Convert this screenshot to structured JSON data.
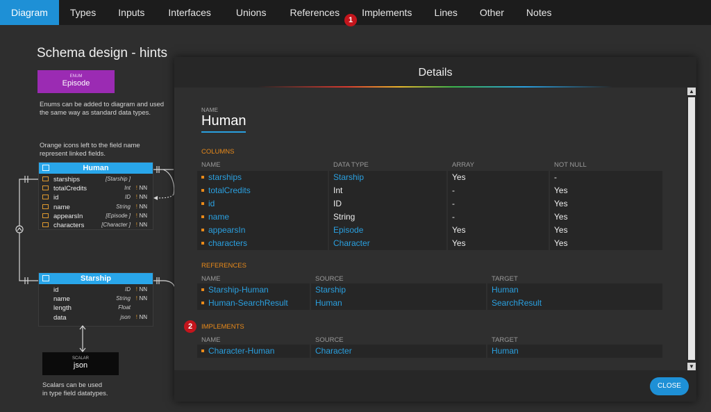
{
  "nav": {
    "tabs": [
      "Diagram",
      "Types",
      "Inputs",
      "Interfaces",
      "Unions",
      "References",
      "Implements",
      "Lines",
      "Other",
      "Notes"
    ],
    "active": "Diagram",
    "badge": "1"
  },
  "diagram": {
    "title": "Schema design - hints",
    "enum": {
      "kind": "ENUM",
      "name": "Episode"
    },
    "enum_hint": [
      "Enums can be added to diagram and used",
      "the same way as standard data types."
    ],
    "linked_hint": [
      "Orange icons left to the field name",
      "represent linked fields."
    ],
    "human": {
      "name": "Human",
      "fields": [
        {
          "name": "starships",
          "type": "[Starship ]",
          "bang": "",
          "nn": ""
        },
        {
          "name": "totalCredits",
          "type": "Int",
          "bang": "!",
          "nn": "NN"
        },
        {
          "name": "id",
          "type": "ID",
          "bang": "!",
          "nn": "NN"
        },
        {
          "name": "name",
          "type": "String",
          "bang": "!",
          "nn": "NN"
        },
        {
          "name": "appearsIn",
          "type": "[Episode ]",
          "bang": "!",
          "nn": "NN"
        },
        {
          "name": "characters",
          "type": "[Character ]",
          "bang": "!",
          "nn": "NN"
        }
      ]
    },
    "starship": {
      "name": "Starship",
      "fields": [
        {
          "name": "id",
          "type": "ID",
          "bang": "!",
          "nn": "NN"
        },
        {
          "name": "name",
          "type": "String",
          "bang": "!",
          "nn": "NN"
        },
        {
          "name": "length",
          "type": "Float",
          "bang": "",
          "nn": ""
        },
        {
          "name": "data",
          "type": "json",
          "bang": "!",
          "nn": "NN"
        }
      ]
    },
    "scalar": {
      "kind": "SCALAR",
      "name": "json"
    },
    "scalar_hint": [
      "Scalars can be used",
      "in type field datatypes."
    ]
  },
  "modal": {
    "title": "Details",
    "name_label": "NAME",
    "name": "Human",
    "columns": {
      "title": "COLUMNS",
      "headers": [
        "NAME",
        "DATA TYPE",
        "ARRAY",
        "NOT NULL"
      ],
      "rows": [
        [
          "starships",
          "Starship",
          "Yes",
          "-"
        ],
        [
          "totalCredits",
          "Int",
          "-",
          "Yes"
        ],
        [
          "id",
          "ID",
          "-",
          "Yes"
        ],
        [
          "name",
          "String",
          "-",
          "Yes"
        ],
        [
          "appearsIn",
          "Episode",
          "Yes",
          "Yes"
        ],
        [
          "characters",
          "Character",
          "Yes",
          "Yes"
        ]
      ]
    },
    "references": {
      "title": "REFERENCES",
      "headers": [
        "NAME",
        "SOURCE",
        "TARGET"
      ],
      "rows": [
        [
          "Starship-Human",
          "Starship",
          "Human"
        ],
        [
          "Human-SearchResult",
          "Human",
          "SearchResult"
        ]
      ]
    },
    "implements": {
      "title": "IMPLEMENTS",
      "badge": "2",
      "headers": [
        "NAME",
        "SOURCE",
        "TARGET"
      ],
      "rows": [
        [
          "Character-Human",
          "Character",
          "Human"
        ]
      ]
    },
    "close_label": "CLOSE"
  },
  "colors": {
    "accent": "#1e90d6",
    "enum": "#9b2bb3",
    "entity_header": "#29a6ea",
    "section_title": "#e98a1a",
    "badge": "#c4151c"
  }
}
